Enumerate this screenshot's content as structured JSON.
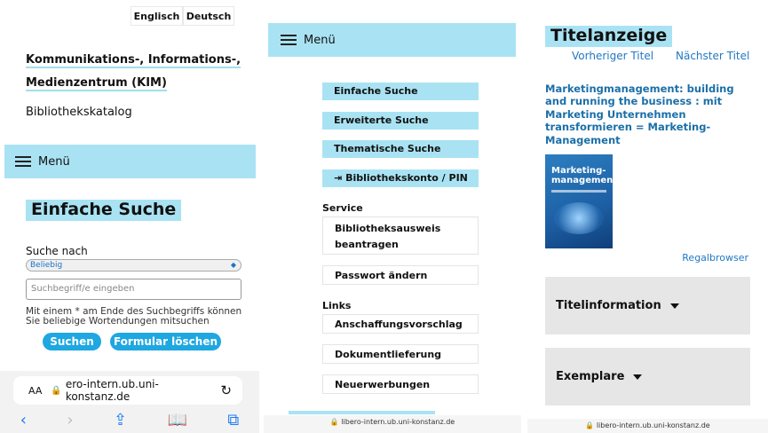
{
  "colors": {
    "accent_bar": "#a9e3f3",
    "button_blue": "#1ea7e1",
    "link_blue": "#2178c4"
  },
  "p1": {
    "lang": [
      "Englisch",
      "Deutsch"
    ],
    "kim_line1": "Kommunikations-, Informations-,",
    "kim_line2": "Medienzentrum (KIM)",
    "catalog": "Bibliothekskatalog",
    "menu": "Menü",
    "title": "Einfache Suche",
    "search_for": "Suche nach",
    "select_value": "Beliebig",
    "input_placeholder": "Suchbegriff/e eingeben",
    "hint": "Mit einem * am Ende des Suchbegriffs können Sie beliebige Wortendungen mitsuchen",
    "search_button": "Suchen",
    "reset_button": "Formular löschen",
    "aa": "AA",
    "url": "ero-intern.ub.uni-konstanz.de"
  },
  "p2": {
    "menu": "Menü",
    "nav": [
      "Einfache Suche",
      "Erweiterte Suche",
      "Thematische Suche",
      "Bibliothekskonto / PIN"
    ],
    "service": "Service",
    "card_line1": "Bibliotheksausweis",
    "card_line2": "beantragen",
    "password": "Passwort ändern",
    "links": "Links",
    "purchase": "Anschaffungsvorschlag",
    "delivery": "Dokumentlieferung",
    "new": "Neuerwerbungen",
    "url": "libero-intern.ub.uni-konstanz.de"
  },
  "p3": {
    "title": "Titelanzeige",
    "prev": "Vorheriger Titel",
    "next": "Nächster Titel",
    "book_title": "Marketingmanagement: building and running the business : mit Marketing Unternehmen transformieren = Marketing-Management",
    "cover_line1": "Marketing-",
    "cover_line2": "management",
    "regal": "Regalbrowser",
    "titelinfo": "Titelinformation",
    "exemplare": "Exemplare",
    "url": "libero-intern.ub.uni-konstanz.de"
  }
}
